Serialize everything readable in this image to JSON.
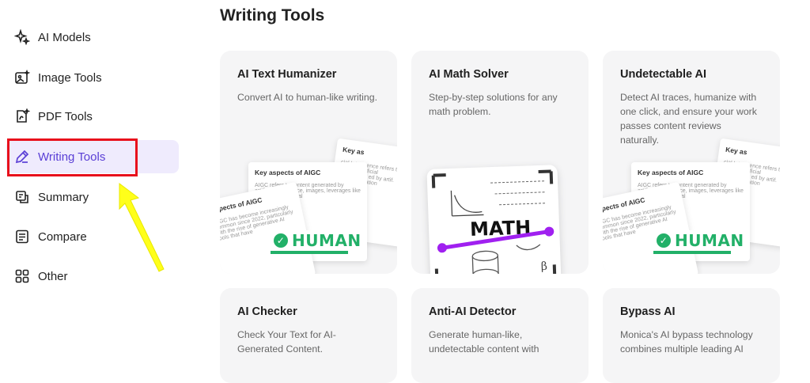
{
  "sidebar": {
    "items": [
      {
        "label": "AI Models",
        "icon": "sparkle-icon"
      },
      {
        "label": "Image Tools",
        "icon": "image-icon"
      },
      {
        "label": "PDF Tools",
        "icon": "pdf-icon"
      },
      {
        "label": "Writing Tools",
        "icon": "pen-icon",
        "active": true
      },
      {
        "label": "Summary",
        "icon": "summary-icon"
      },
      {
        "label": "Compare",
        "icon": "compare-icon"
      },
      {
        "label": "Other",
        "icon": "grid-icon"
      }
    ]
  },
  "annotation": {
    "highlight_color": "#e8101c",
    "arrow_color": "#ffff1a"
  },
  "main": {
    "title": "Writing Tools",
    "cards": [
      {
        "title": "AI Text Humanizer",
        "desc": "Convert AI to human-like writing.",
        "art": "humanizer"
      },
      {
        "title": "AI Math Solver",
        "desc": "Step-by-step solutions for any math problem.",
        "art": "math"
      },
      {
        "title": "Undetectable AI",
        "desc": "Detect AI traces, humanize with one click, and ensure your work passes content reviews naturally.",
        "art": "humanizer"
      },
      {
        "title": "AI Checker",
        "desc": "Check Your Text for AI-Generated Content."
      },
      {
        "title": "Anti-AI Detector",
        "desc": "Generate human-like, undetectable content with"
      },
      {
        "title": "Bypass AI",
        "desc": "Monica's AI bypass technology combines multiple leading AI"
      }
    ],
    "art_text": {
      "paper_heading": "Key aspects of AIGC",
      "paper_heading_2": "Key as",
      "paper_heading_3": "aspects of AIGC",
      "paper_body": "AIGC refers to content generated by artificial intelligence, images, leverages like GPT for adversarial",
      "paper_body_2": "AIGC has become increasingly common since 2022, particularly with the rise of generative AI tools that have",
      "paper_body_3": "cial Intelligence refers to any cont rtificial intelligence ed by artif. Here xplanation",
      "badge": "HUMAN",
      "math_word": "MATH"
    },
    "colors": {
      "accent": "#5a3fd6",
      "active_bg": "#efebfd",
      "human_green": "#22b068",
      "math_purple": "#a020f0"
    }
  }
}
